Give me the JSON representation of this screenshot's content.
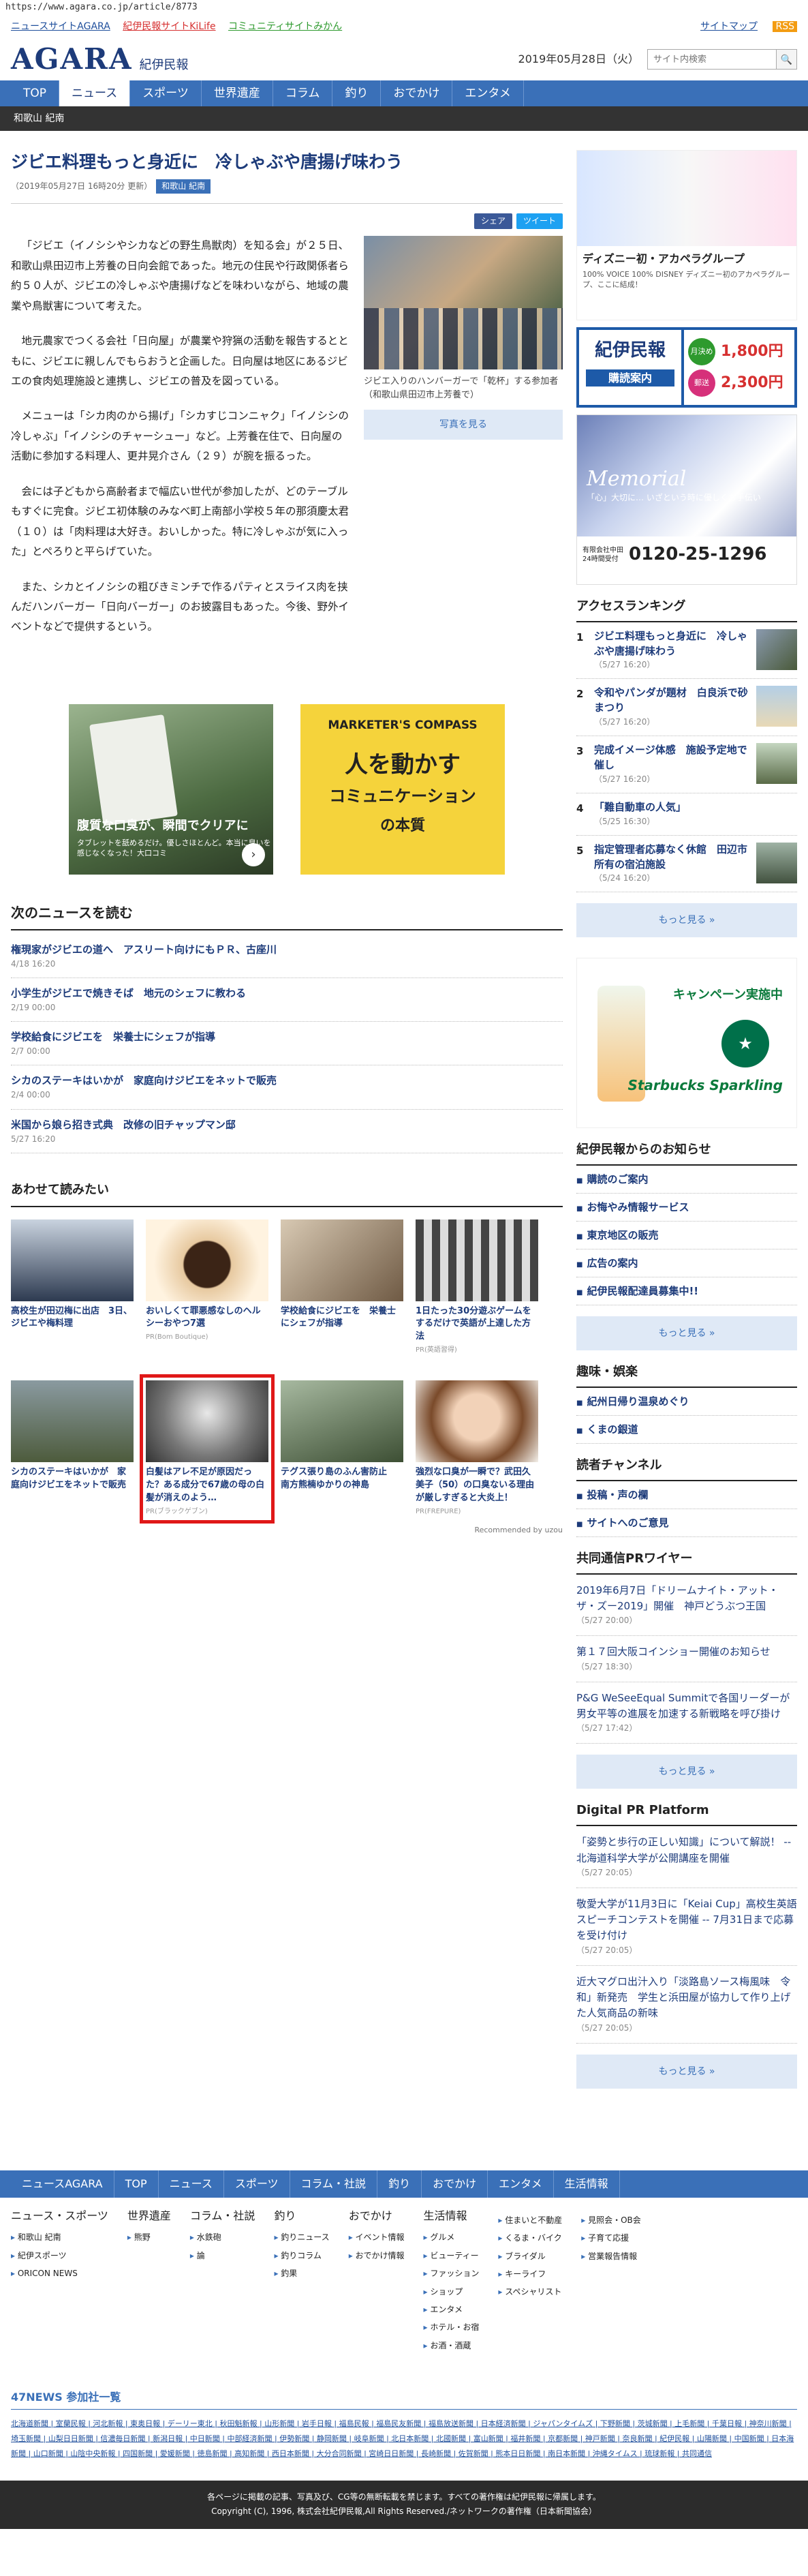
{
  "url": "https://www.agara.co.jp/article/8773",
  "topbar": {
    "links": [
      "ニュースサイトAGARA",
      "紀伊民報サイトKiLife",
      "コミュニティサイトみかん"
    ],
    "sitemap": "サイトマップ",
    "rss": "RSS"
  },
  "header": {
    "logo": "AGARA",
    "logo_sub": "紀伊民報",
    "date": "2019年05月28日（火）",
    "search_placeholder": "サイト内検索",
    "search_icon": "search-icon"
  },
  "gnav": [
    "TOP",
    "ニュース",
    "スポーツ",
    "世界遺産",
    "コラム",
    "釣り",
    "おでかけ",
    "エンタメ"
  ],
  "subnav": "和歌山 紀南",
  "article": {
    "title": "ジビエ料理もっと身近に　冷しゃぶや唐揚げ味わう",
    "date": "（2019年05月27日 16時20分 更新）",
    "tag": "和歌山 紀南",
    "share_fb": "シェア",
    "share_tw": "ツイート",
    "paragraphs": [
      "「ジビエ（イノシシやシカなどの野生鳥獣肉）を知る会」が２５日、和歌山県田辺市上芳養の日向会館であった。地元の住民や行政関係者ら約５０人が、ジビエの冷しゃぶや唐揚げなどを味わいながら、地域の農業や鳥獣害について考えた。",
      "地元農家でつくる会社「日向屋」が農業や狩猟の活動を報告するとともに、ジビエに親しんでもらおうと企画した。日向屋は地区にあるジビエの食肉処理施設と連携し、ジビエの普及を図っている。",
      "メニューは「シカ肉のから揚げ」「シカすじコンニャク」「イノシシの冷しゃぶ」「イノシシのチャーシュー」など。上芳養在住で、日向屋の活動に参加する料理人、更井晃介さん（２９）が腕を振るった。",
      "会には子どもから高齢者まで幅広い世代が参加したが、どのテーブルもすぐに完食。ジビエ初体験のみなべ町上南部小学校５年の那須慶太君（１０）は「肉料理は大好き。おいしかった。特に冷しゃぶが気に入った」とぺろりと平らげていた。",
      "また、シカとイノシシの粗びきミンチで作るパティとスライス肉を挟んだハンバーガー「日向バーガー」のお披露目もあった。今後、野外イベントなどで提供するという。"
    ],
    "photo_caption": "ジビエ入りのハンバーガーで「乾杯」する参加者（和歌山県田辺市上芳養で）",
    "photo_button": "写真を見る"
  },
  "ads": {
    "ad1_title": "腹質な口臭が、瞬間でクリアに",
    "ad1_sub": "タブレットを舐めるだけ。優しさほとんど。本当に臭いを感じなくなった！大口コミ",
    "ad2_head": "MARKETER'S COMPASS",
    "ad2_line1": "人を動かす",
    "ad2_line2": "コミュニケーション",
    "ad2_line3": "の本質"
  },
  "next_news": {
    "heading": "次のニュースを読む",
    "items": [
      {
        "title": "権現家がジビエの道へ　アスリート向けにもＰＲ、古座川",
        "date": "4/18 16:20"
      },
      {
        "title": "小学生がジビエで焼きそば　地元のシェフに教わる",
        "date": "2/19 00:00"
      },
      {
        "title": "学校給食にジビエを　栄養士にシェフが指導",
        "date": "2/7 00:00"
      },
      {
        "title": "シカのステーキはいかが　家庭向けジビエをネットで販売",
        "date": "2/4 00:00"
      },
      {
        "title": "米国から娘ら招き式典　改修の旧チャップマン邸",
        "date": "5/27 16:20"
      }
    ]
  },
  "recommend": {
    "heading": "あわせて読みたい",
    "items": [
      {
        "title": "高校生が田辺梅に出店　3日、ジビエや梅料理",
        "pr": ""
      },
      {
        "title": "おいしくて罪悪感なしのヘルシーおやつ7選",
        "pr": "PR(Bom Boutique)"
      },
      {
        "title": "学校給食にジビエを　栄養士にシェフが指導",
        "pr": ""
      },
      {
        "title": "1日たった30分遊ぶゲームをするだけで英語が上達した方法",
        "pr": "PR(英語習得)"
      },
      {
        "title": "シカのステーキはいかが　家庭向けジビエをネットで販売",
        "pr": ""
      },
      {
        "title": "白髪はアレ不足が原因だった？ある成分で67歳の母の白髪が消えのよう…",
        "pr": "PR(ブラックゲブン)"
      },
      {
        "title": "テグス張り島のふん害防止　南方熊楠ゆかりの神島",
        "pr": ""
      },
      {
        "title": "強烈な口臭が一瞬で？武田久美子（50）の口臭ないる理由が厳しすぎると大炎上！",
        "pr": "PR(FREPURE)"
      }
    ],
    "footer": "Recommended by  uzou"
  },
  "sidebar": {
    "ad1_title": "ディズニー初・アカペラグループ",
    "ad1_text": "100% VOICE 100% DISNEY ディズニー初のアカペラグループ、ここに結成！",
    "sub_logo": "紀伊民報",
    "sub_label": "購読案内",
    "price1_label": "月決め",
    "price1": "1,800円",
    "price2_label": "郵送",
    "price2": "2,300円",
    "memo_title": "Memorial",
    "memo_sub": "「心」大切に… いざという時に優しくお手伝い",
    "memo_hours": "24時間受付",
    "memo_tel": "0120-25-1296",
    "memo_company": "有限会社中田",
    "ranking_heading": "アクセスランキング",
    "ranking": [
      {
        "n": "1",
        "title": "ジビエ料理もっと身近に　冷しゃぶや唐揚げ味わう",
        "date": "（5/27 16:20）"
      },
      {
        "n": "2",
        "title": "令和やパンダが題材　白良浜で砂まつり",
        "date": "（5/27 16:20）"
      },
      {
        "n": "3",
        "title": "完成イメージ体感　施設予定地で催し",
        "date": "（5/27 16:20）"
      },
      {
        "n": "4",
        "title": "「難自動車の人気」",
        "date": "（5/25 16:30）"
      },
      {
        "n": "5",
        "title": "指定管理者応募なく休館　田辺市所有の宿泊施設",
        "date": "（5/24 16:20）"
      }
    ],
    "more": "もっと見る »",
    "ad2_head": "キャンペーン実施中",
    "ad2_brand": "Starbucks Sparkling",
    "notice_heading": "紀伊民報からのお知らせ",
    "notice": [
      "購読のご案内",
      "お悔やみ情報サービス",
      "東京地区の販売",
      "広告の案内",
      "紀伊民報配達員募集中!!"
    ],
    "hobby_heading": "趣味・娯楽",
    "hobby": [
      "紀州日帰り温泉めぐり",
      "くまの銀道"
    ],
    "reader_heading": "読者チャンネル",
    "reader": [
      "投稿・声の欄",
      "サイトへのご意見"
    ],
    "wire_heading": "共同通信PRワイヤー",
    "wire": [
      {
        "title": "2019年6月7日「ドリームナイト・アット・ザ・ズー2019」開催　神戸どうぶつ王国",
        "date": "（5/27 20:00）"
      },
      {
        "title": "第１７回大阪コインショー開催のお知らせ",
        "date": "（5/27 18:30）"
      },
      {
        "title": "P&G WeSeeEqual Summitで各国リーダーが男女平等の進展を加速する新戦略を呼び掛け",
        "date": "（5/27 17:42）"
      }
    ],
    "dpr_heading": "Digital PR Platform",
    "dpr": [
      {
        "title": "「姿勢と歩行の正しい知識」について解説！ -- 北海道科学大学が公開講座を開催",
        "date": "（5/27 20:05）"
      },
      {
        "title": "敬愛大学が11月3日に「Keiai Cup」高校生英語スピーチコンテストを開催 -- 7月31日まで応募を受け付け",
        "date": "（5/27 20:05）"
      },
      {
        "title": "近大マグロ出汁入り「淡路島ソース梅風味　令和」新発売　学生と浜田屋が協力して作り上げた人気商品の新味",
        "date": "（5/27 20:05）"
      }
    ]
  },
  "footer": {
    "nav": [
      "ニュースAGARA",
      "TOP",
      "ニュース",
      "スポーツ",
      "コラム・社説",
      "釣り",
      "おでかけ",
      "エンタメ",
      "生活情報"
    ],
    "cols": [
      {
        "h": "ニュース・スポーツ",
        "items": [
          "和歌山 紀南",
          "紀伊スポーツ",
          "ORICON NEWS"
        ]
      },
      {
        "h": "世界遺産",
        "items": [
          "熊野"
        ]
      },
      {
        "h": "コラム・社説",
        "items": [
          "水鉄砲",
          "論"
        ]
      },
      {
        "h": "釣り",
        "items": [
          "釣りニュース",
          "釣りコラム",
          "釣果"
        ]
      },
      {
        "h": "おでかけ",
        "items": [
          "イベント情報",
          "おでかけ情報"
        ]
      },
      {
        "h": "生活情報",
        "items": [
          "グルメ",
          "ビューティー",
          "ファッション",
          "ショップ",
          "エンタメ",
          "ホテル・お宿",
          "お酒・酒蔵"
        ]
      },
      {
        "h": "",
        "items": [
          "住まいと不動産",
          "くるま・バイク",
          "ブライダル",
          "キーライフ",
          "スペシャリスト"
        ]
      },
      {
        "h": "",
        "items": [
          "見照会・OB会",
          "子育て応援",
          "営業報告情報"
        ]
      }
    ],
    "news47_heading": "47NEWS 参加社一覧",
    "news47_list": "北海道新聞 | 室蘭民報 | 河北新報 | 東奥日報 | デーリー東北 | 秋田魁新報 | 山形新聞 | 岩手日報 | 福島民報 | 福島民友新聞 | 福島放送新聞 | 日本経済新聞 | ジャパンタイムズ | 下野新聞 | 茨城新聞 | 上毛新聞 | 千葉日報 | 神奈川新聞 | 埼玉新聞 | 山梨日日新聞 | 信濃毎日新聞 | 新潟日報 | 中日新聞 | 中部経済新聞 | 伊勢新聞 | 静岡新聞 | 岐阜新聞 | 北日本新聞 | 北國新聞 | 富山新聞 | 福井新聞 | 京都新聞 | 神戸新聞 | 奈良新聞 | 紀伊民報 | 山陽新聞 | 中国新聞 | 日本海新聞 | 山口新聞 | 山陰中央新報 | 四国新聞 | 愛媛新聞 | 徳島新聞 | 高知新聞 | 西日本新聞 | 大分合同新聞 | 宮崎日日新聞 | 長崎新聞 | 佐賀新聞 | 熊本日日新聞 | 南日本新聞 | 沖縄タイムス | 琉球新報 | 共同通信",
    "copy1": "各ページに掲載の記事、写真及び、CG等の無断転載を禁じます。すべての著作権は紀伊民報に帰属します。",
    "copy2": "Copyright (C), 1996, 株式会社紀伊民報,All Rights Reserved./ネットワークの著作権（日本新聞協会）"
  },
  "colors": {
    "brand": "#1d3b7a",
    "nav": "#3a70b8",
    "highlight": "#e01818"
  }
}
